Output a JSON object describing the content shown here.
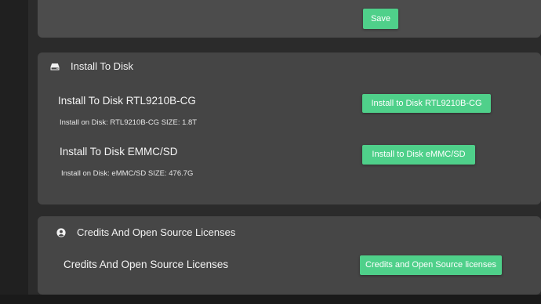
{
  "save_section": {
    "save_label": "Save"
  },
  "install_section": {
    "title": "Install To Disk",
    "icon": "drive-icon",
    "disks": [
      {
        "title": "Install To Disk RTL9210B-CG",
        "info": "Install on Disk: RTL9210B-CG SIZE: 1.8T",
        "button_label": "Install to Disk RTL9210B-CG"
      },
      {
        "title": "Install To Disk EMMC/SD",
        "info": "Install on Disk: eMMC/SD SIZE: 476.7G",
        "button_label": "Install to Disk eMMC/SD"
      }
    ]
  },
  "credits_section": {
    "title": "Credits And Open Source Licenses",
    "icon": "user-circle-icon",
    "row_title": "Credits And Open Source Licenses",
    "button_label": "Credits and Open Source licenses"
  },
  "colors": {
    "accent": "#4fd08a",
    "card_bg": "#454545",
    "page_bg": "#2b2b2b"
  }
}
